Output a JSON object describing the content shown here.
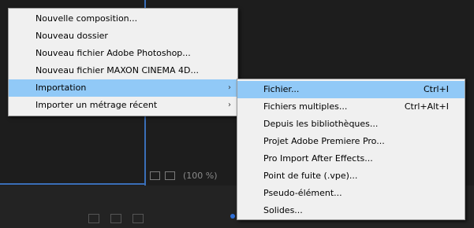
{
  "toolbar": {
    "zoom": "(100 %)"
  },
  "main_menu": {
    "items": [
      {
        "label": "Nouvelle composition..."
      },
      {
        "label": "Nouveau dossier"
      },
      {
        "label": "Nouveau fichier Adobe Photoshop..."
      },
      {
        "label": "Nouveau fichier MAXON CINEMA 4D..."
      },
      {
        "label": "Importation",
        "arrow": "›"
      },
      {
        "label": "Importer un métrage récent",
        "arrow": "›"
      }
    ]
  },
  "sub_menu": {
    "items": [
      {
        "label": "Fichier...",
        "shortcut": "Ctrl+I"
      },
      {
        "label": "Fichiers multiples...",
        "shortcut": "Ctrl+Alt+I"
      },
      {
        "label": "Depuis les bibliothèques..."
      },
      {
        "label": "Projet Adobe Premiere Pro..."
      },
      {
        "label": "Pro Import After Effects..."
      },
      {
        "label": "Point de fuite (.vpe)..."
      },
      {
        "label": "Pseudo-élément..."
      },
      {
        "label": "Solides..."
      }
    ]
  },
  "colors": {
    "highlight": "#91c9f7",
    "panel_border": "#3a6fb8",
    "background": "#1d1d1d"
  }
}
